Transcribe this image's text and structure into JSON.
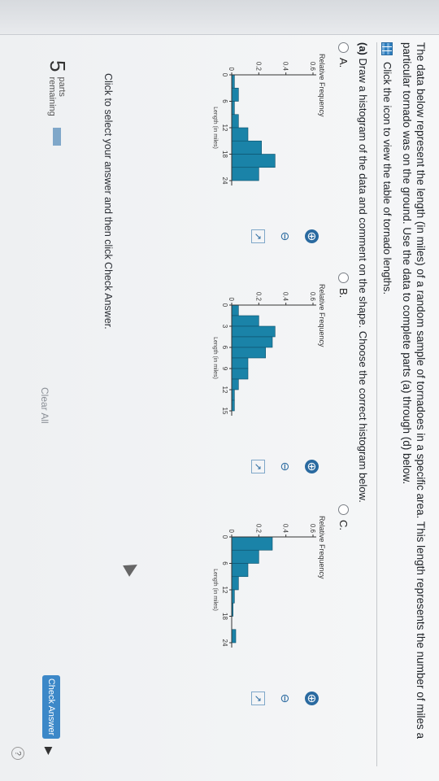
{
  "intro_text": "The data below represent the length (in miles) of a random sample of tornadoes in a specific area. This length represents the number of miles a particular tornado was on the ground. Use the data to complete parts (a) through (d) below.",
  "icon_link_text": "Click the icon to view the table of tornado lengths.",
  "question": {
    "part": "(a)",
    "text": "Draw a histogram of the data and comment on the shape. Choose the correct histogram below."
  },
  "options": [
    {
      "label": "A.",
      "ylabel": "Relative Frequency",
      "xlabel": "Length (in miles)",
      "yticks": [
        "0",
        "0.2",
        "0.4",
        "0.6"
      ],
      "xticks": [
        "0",
        "6",
        "12",
        "18",
        "24"
      ]
    },
    {
      "label": "B.",
      "ylabel": "Relative Frequency",
      "xlabel": "Length (in miles)",
      "yticks": [
        "0",
        "0.2",
        "0.4",
        "0.6"
      ],
      "xticks": [
        "0",
        "3",
        "6",
        "9",
        "12",
        "15"
      ]
    },
    {
      "label": "C.",
      "ylabel": "Relative Frequency",
      "xlabel": "Length (in miles)",
      "yticks": [
        "0",
        "0.2",
        "0.4",
        "0.6"
      ],
      "xticks": [
        "0",
        "6",
        "12",
        "18",
        "24"
      ]
    }
  ],
  "chart_data": [
    {
      "type": "bar",
      "title": "A.",
      "ylabel": "Relative Frequency",
      "xlabel": "Length (in miles)",
      "ylim": [
        0,
        0.6
      ],
      "bin_edges": [
        0,
        3,
        6,
        9,
        12,
        15,
        18,
        21,
        24
      ],
      "values": [
        0.02,
        0.05,
        0.02,
        0.05,
        0.12,
        0.22,
        0.32,
        0.2
      ]
    },
    {
      "type": "bar",
      "title": "B.",
      "ylabel": "Relative Frequency",
      "xlabel": "Length (in miles)",
      "ylim": [
        0,
        0.6
      ],
      "bin_edges": [
        0,
        1.5,
        3,
        4.5,
        6,
        7.5,
        9,
        10.5,
        12,
        13.5,
        15
      ],
      "values": [
        0.05,
        0.2,
        0.32,
        0.3,
        0.25,
        0.12,
        0.12,
        0.05,
        0.02,
        0.02
      ]
    },
    {
      "type": "bar",
      "title": "C.",
      "ylabel": "Relative Frequency",
      "xlabel": "Length (in miles)",
      "ylim": [
        0,
        0.6
      ],
      "bin_edges": [
        0,
        3,
        6,
        9,
        12,
        15,
        18,
        21,
        24
      ],
      "values": [
        0.3,
        0.2,
        0.12,
        0.05,
        0.02,
        0.01,
        0.0,
        0.03
      ]
    }
  ],
  "footer_instruction": "Click to select your answer and then click Check Answer.",
  "parts": {
    "count": "5",
    "label_line1": "parts",
    "label_line2": "remaining",
    "completed_fraction": 0.2
  },
  "clear_all": "Clear All",
  "check_answer": "Check Answer",
  "colors": {
    "bar": "#1a83a8",
    "accent": "#2a6aa0"
  }
}
